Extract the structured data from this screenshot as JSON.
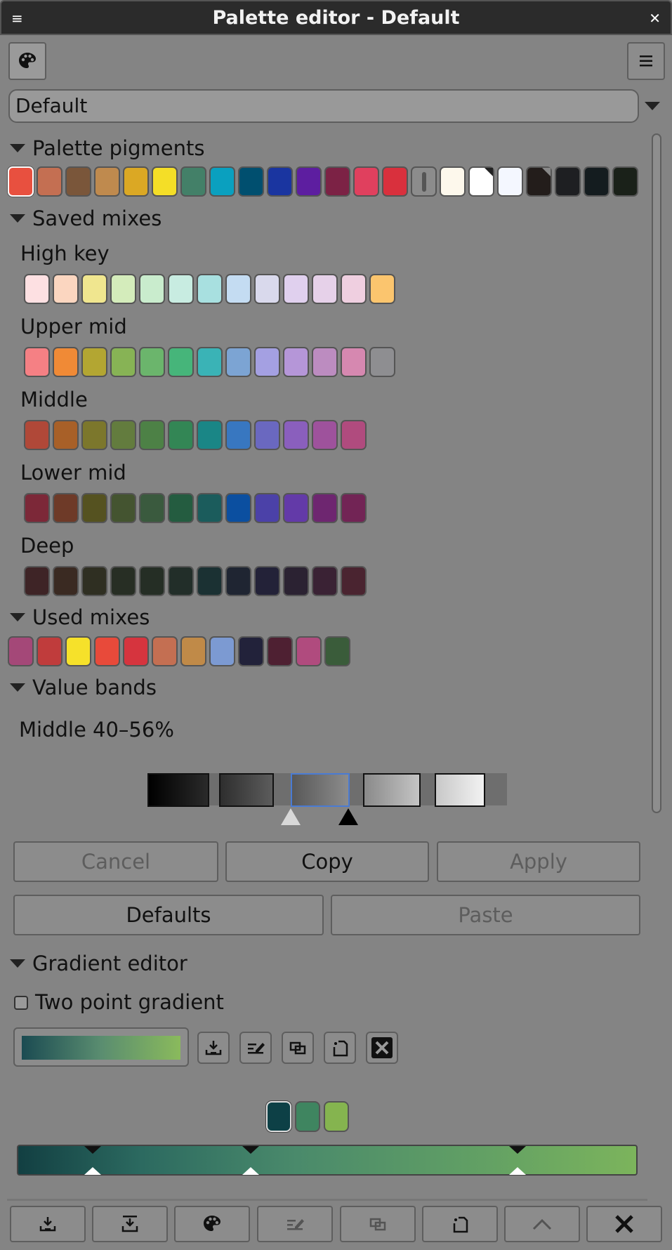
{
  "window": {
    "title": "Palette editor - Default"
  },
  "palette_selector": {
    "value": "Default"
  },
  "sections": {
    "pigments": "Palette pigments",
    "saved": "Saved mixes",
    "used": "Used mixes",
    "bands": "Value bands",
    "gradient": "Gradient editor"
  },
  "pigments": [
    "#e8503f",
    "#c46f52",
    "#7a563a",
    "#bf8a4e",
    "#dba824",
    "#f4de27",
    "#438068",
    "#0aa0bf",
    "#004f6f",
    "#1a35a0",
    "#5d1ea0",
    "#7c2245",
    "#e0405e",
    "#d9303d",
    "#8c8c8c",
    "#fdf8ec",
    "#ffffff",
    "#f4f7ff",
    "#231d1b",
    "#1e1f22",
    "#141c1f",
    "#1a2119"
  ],
  "saved_mixes": [
    {
      "label": "High key",
      "colors": [
        "#fde0e2",
        "#fbd6c0",
        "#f0e68f",
        "#d4ecbb",
        "#c9eccd",
        "#c8ece1",
        "#a8e0e0",
        "#c4dcf2",
        "#d9d9ec",
        "#e0d0ee",
        "#e6d1e9",
        "#efcfe0",
        "#fbc56e"
      ]
    },
    {
      "label": "Upper mid",
      "colors": [
        "#f58084",
        "#f08a36",
        "#b3a632",
        "#87b355",
        "#6bb56c",
        "#46b57a",
        "#3ab3b6",
        "#7ca4d3",
        "#a4a0e2",
        "#b596d8",
        "#bc8cc0",
        "#d688b0",
        "#8e8e91"
      ]
    },
    {
      "label": "Middle",
      "colors": [
        "#b04838",
        "#a86028",
        "#7c772c",
        "#637c3e",
        "#4d8146",
        "#338655",
        "#1a8686",
        "#3877c0",
        "#6a68c0",
        "#8a5fbd",
        "#9e529c",
        "#b04b7e"
      ]
    },
    {
      "label": "Lower mid",
      "colors": [
        "#7c2838",
        "#6e3a28",
        "#555220",
        "#445430",
        "#3a5a3e",
        "#245c40",
        "#1b5c5c",
        "#0b4fa0",
        "#4b41a8",
        "#633aa8",
        "#6e2670",
        "#722455"
      ]
    },
    {
      "label": "Deep",
      "colors": [
        "#3e2426",
        "#3a2a22",
        "#2f2f22",
        "#272e24",
        "#252e25",
        "#222e29",
        "#1b3133",
        "#1f2532",
        "#232238",
        "#2b2232",
        "#3a2234",
        "#4a2430"
      ]
    }
  ],
  "used_mixes": [
    "#a44878",
    "#c03c3c",
    "#f6e12a",
    "#e84a3a",
    "#d6343e",
    "#c46f52",
    "#c08a48",
    "#7c9ad2",
    "#22223a",
    "#4e2032",
    "#b04b7e",
    "#3a5c3a"
  ],
  "value_bands": {
    "label": "Middle 40–56%"
  },
  "buttons": {
    "cancel": "Cancel",
    "copy": "Copy",
    "apply": "Apply",
    "defaults": "Defaults",
    "paste": "Paste"
  },
  "gradient": {
    "two_point_label": "Two point gradient",
    "two_point_checked": false,
    "stops": [
      "#0d4046",
      "#3f8560",
      "#85b44f"
    ]
  }
}
